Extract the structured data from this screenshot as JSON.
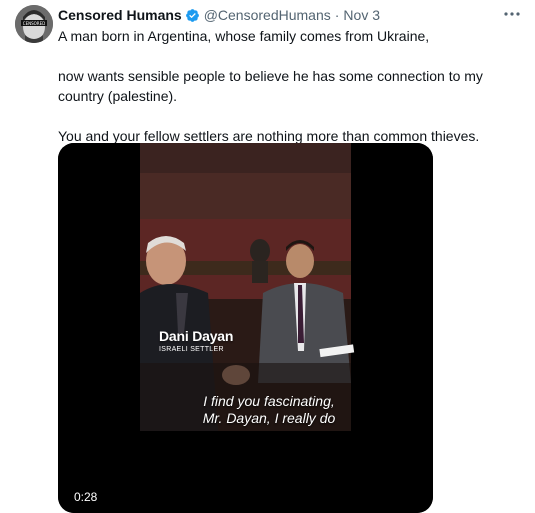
{
  "author": {
    "display_name": "Censored Humans",
    "handle": "@CensoredHumans",
    "separator": "·",
    "date": "Nov 3",
    "avatar_icon": "masked-face-avatar",
    "verified_color": "#1d9bf0",
    "avatar_badge_text": "CENSORED"
  },
  "tweet": {
    "paragraphs": [
      "A man born in Argentina, whose family comes from Ukraine,",
      "now wants sensible people to believe he has some connection to my country (palestine).",
      "You and your fellow settlers are nothing more than common thieves."
    ]
  },
  "video": {
    "lower_third_name": "Dani Dayan",
    "lower_third_title": "ISRAELI SETTLER",
    "subtitle_lines": [
      "I find you fascinating,",
      "Mr. Dayan, I really do"
    ],
    "duration": "0:28"
  },
  "colors": {
    "text": "#0f1419",
    "secondary": "#536471",
    "accent": "#1d9bf0"
  },
  "icons": {
    "more": "more-horizontal-icon",
    "verified": "verified-badge-icon"
  }
}
